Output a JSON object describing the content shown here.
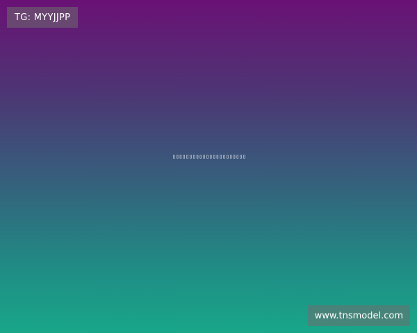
{
  "overlay": {
    "tag": "TG: MYYJJPP",
    "center_text": "▯▯▯▯▯▯▯▯▯▯▯▯▯▯▯▯▯▯▯▯▯▯▯▯▯▯",
    "site": "www.tnsmodel.com"
  },
  "colors": {
    "gradient_top": "#6a1076",
    "gradient_middle": "#34617d",
    "gradient_bottom": "#17a88a"
  }
}
